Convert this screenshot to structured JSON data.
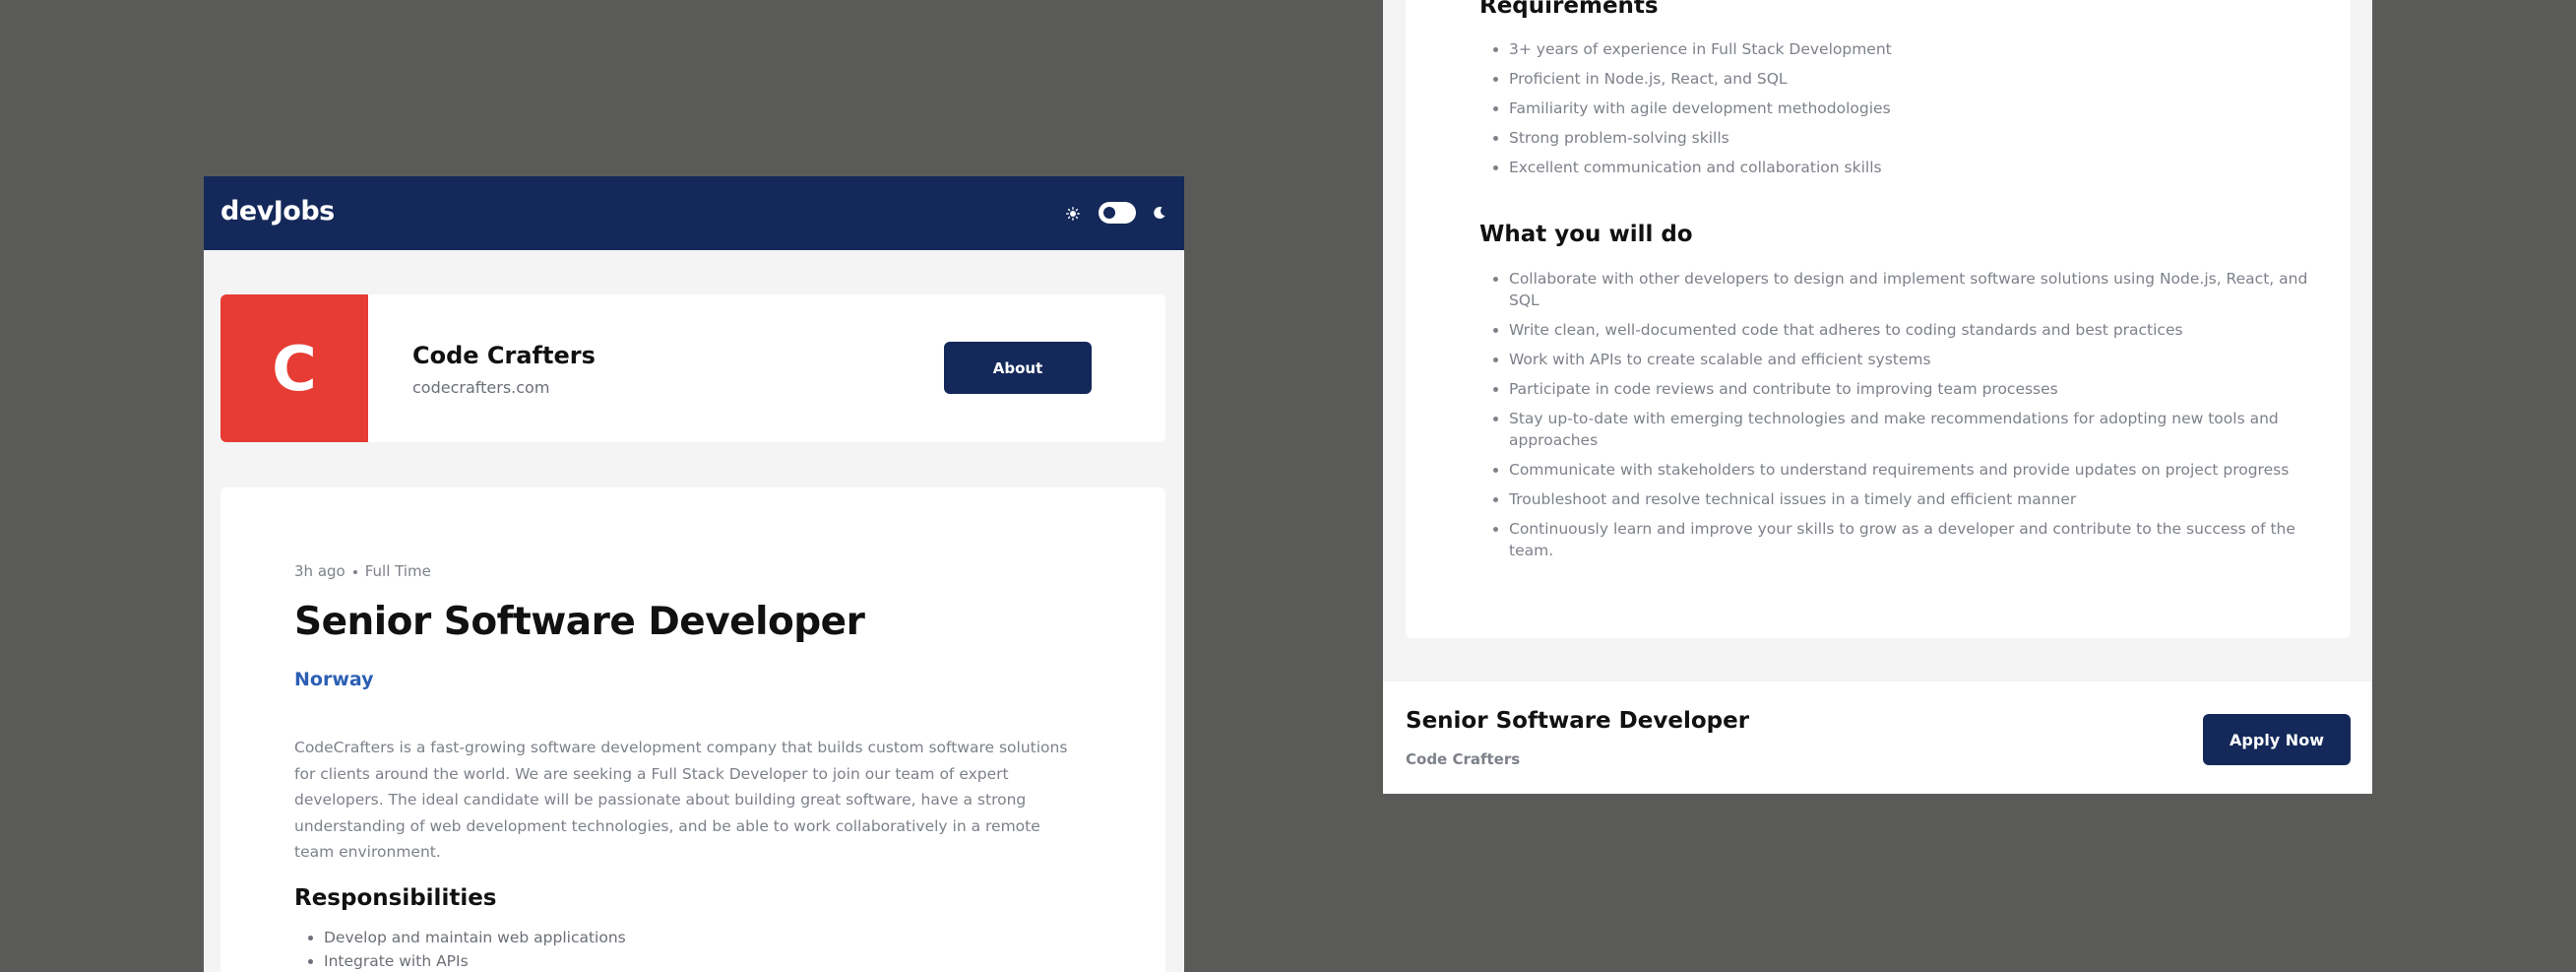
{
  "header": {
    "logo": "devJobs",
    "theme_icons": [
      "sun-icon",
      "moon-icon"
    ]
  },
  "company": {
    "initial": "C",
    "name": "Code Crafters",
    "website": "codecrafters.com",
    "about_label": "About"
  },
  "job": {
    "posted": "3h ago",
    "type": "Full Time",
    "title": "Senior Software Developer",
    "location": "Norway",
    "description": "CodeCrafters is a fast-growing software development company that builds custom software solutions for clients around the world. We are seeking a Full Stack Developer to join our team of expert developers. The ideal candidate will be passionate about building great software, have a strong understanding of web development technologies, and be able to work collaboratively in a remote team environment.",
    "responsibilities_heading": "Responsibilities",
    "responsibilities": [
      "Develop and maintain web applications",
      "Integrate with APIs"
    ],
    "requirements_heading": "Requirements",
    "requirements": [
      "3+ years of experience in Full Stack Development",
      "Proficient in Node.js, React, and SQL",
      "Familiarity with agile development methodologies",
      "Strong problem-solving skills",
      "Excellent communication and collaboration skills"
    ],
    "what_you_do_heading": "What you will do",
    "what_you_do": [
      "Collaborate with other developers to design and implement software solutions using Node.js, React, and SQL",
      "Write clean, well-documented code that adheres to coding standards and best practices",
      "Work with APIs to create scalable and efficient systems",
      "Participate in code reviews and contribute to improving team processes",
      "Stay up-to-date with emerging technologies and make recommendations for adopting new tools and approaches",
      "Communicate with stakeholders to understand requirements and provide updates on project progress",
      "Troubleshoot and resolve technical issues in a timely and efficient manner",
      "Continuously learn and improve your skills to grow as a developer and contribute to the success of the team."
    ]
  },
  "footer": {
    "title": "Senior Software Developer",
    "company": "Code Crafters",
    "apply_label": "Apply Now"
  },
  "colors": {
    "navy": "#14295a",
    "logo_red": "#e63c33",
    "location_blue": "#2c5fb3",
    "backdrop": "#5a5a58"
  }
}
